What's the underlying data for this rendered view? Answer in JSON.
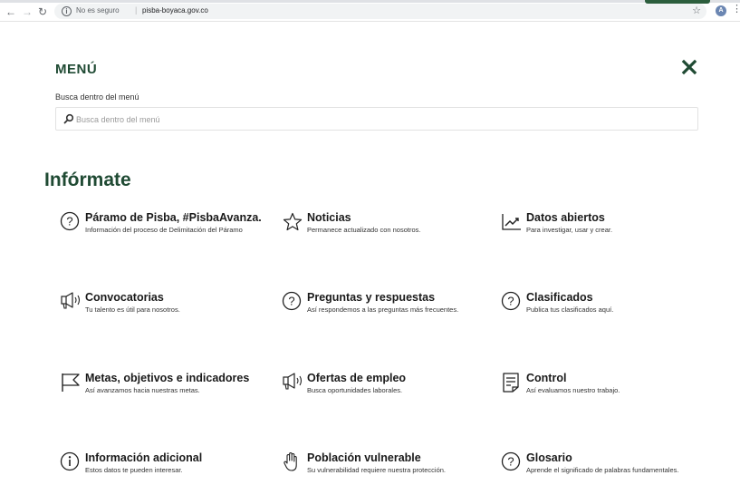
{
  "browser": {
    "security_label": "No es seguro",
    "url": "pisba-boyaca.gov.co",
    "profile_initial": "A"
  },
  "menu": {
    "title": "MENÚ",
    "search_label": "Busca dentro del menú",
    "search_placeholder": "Busca dentro del menú"
  },
  "section": {
    "title": "Infórmate",
    "items": [
      {
        "icon": "question-circle-icon",
        "title": "Páramo de Pisba, #PisbaAvanza.",
        "desc": "Información del proceso de Delimitación del Páramo"
      },
      {
        "icon": "star-outline-icon",
        "title": "Noticias",
        "desc": "Permanece actualizado con nosotros."
      },
      {
        "icon": "trend-chart-icon",
        "title": "Datos abiertos",
        "desc": "Para investigar, usar y crear."
      },
      {
        "icon": "megaphone-icon",
        "title": "Convocatorias",
        "desc": "Tu talento es útil para nosotros."
      },
      {
        "icon": "question-circle-icon",
        "title": "Preguntas y respuestas",
        "desc": "Así respondemos a las preguntas más frecuentes."
      },
      {
        "icon": "question-circle-icon",
        "title": "Clasificados",
        "desc": "Publica tus clasificados aquí."
      },
      {
        "icon": "flag-icon",
        "title": "Metas, objetivos e indicadores",
        "desc": "Así avanzamos hacia nuestras metas."
      },
      {
        "icon": "megaphone-icon",
        "title": "Ofertas de empleo",
        "desc": "Busca oportunidades laborales."
      },
      {
        "icon": "document-icon",
        "title": "Control",
        "desc": "Así evaluamos nuestro trabajo."
      },
      {
        "icon": "info-circle-icon",
        "title": "Información adicional",
        "desc": "Estos datos te pueden interesar."
      },
      {
        "icon": "hand-icon",
        "title": "Población vulnerable",
        "desc": "Su vulnerabilidad requiere nuestra protección."
      },
      {
        "icon": "question-circle-icon",
        "title": "Glosario",
        "desc": "Aprende el significado de palabras fundamentales."
      }
    ]
  },
  "colors": {
    "brand_green": "#1f4a33",
    "text_dark": "#1a1a1a"
  }
}
